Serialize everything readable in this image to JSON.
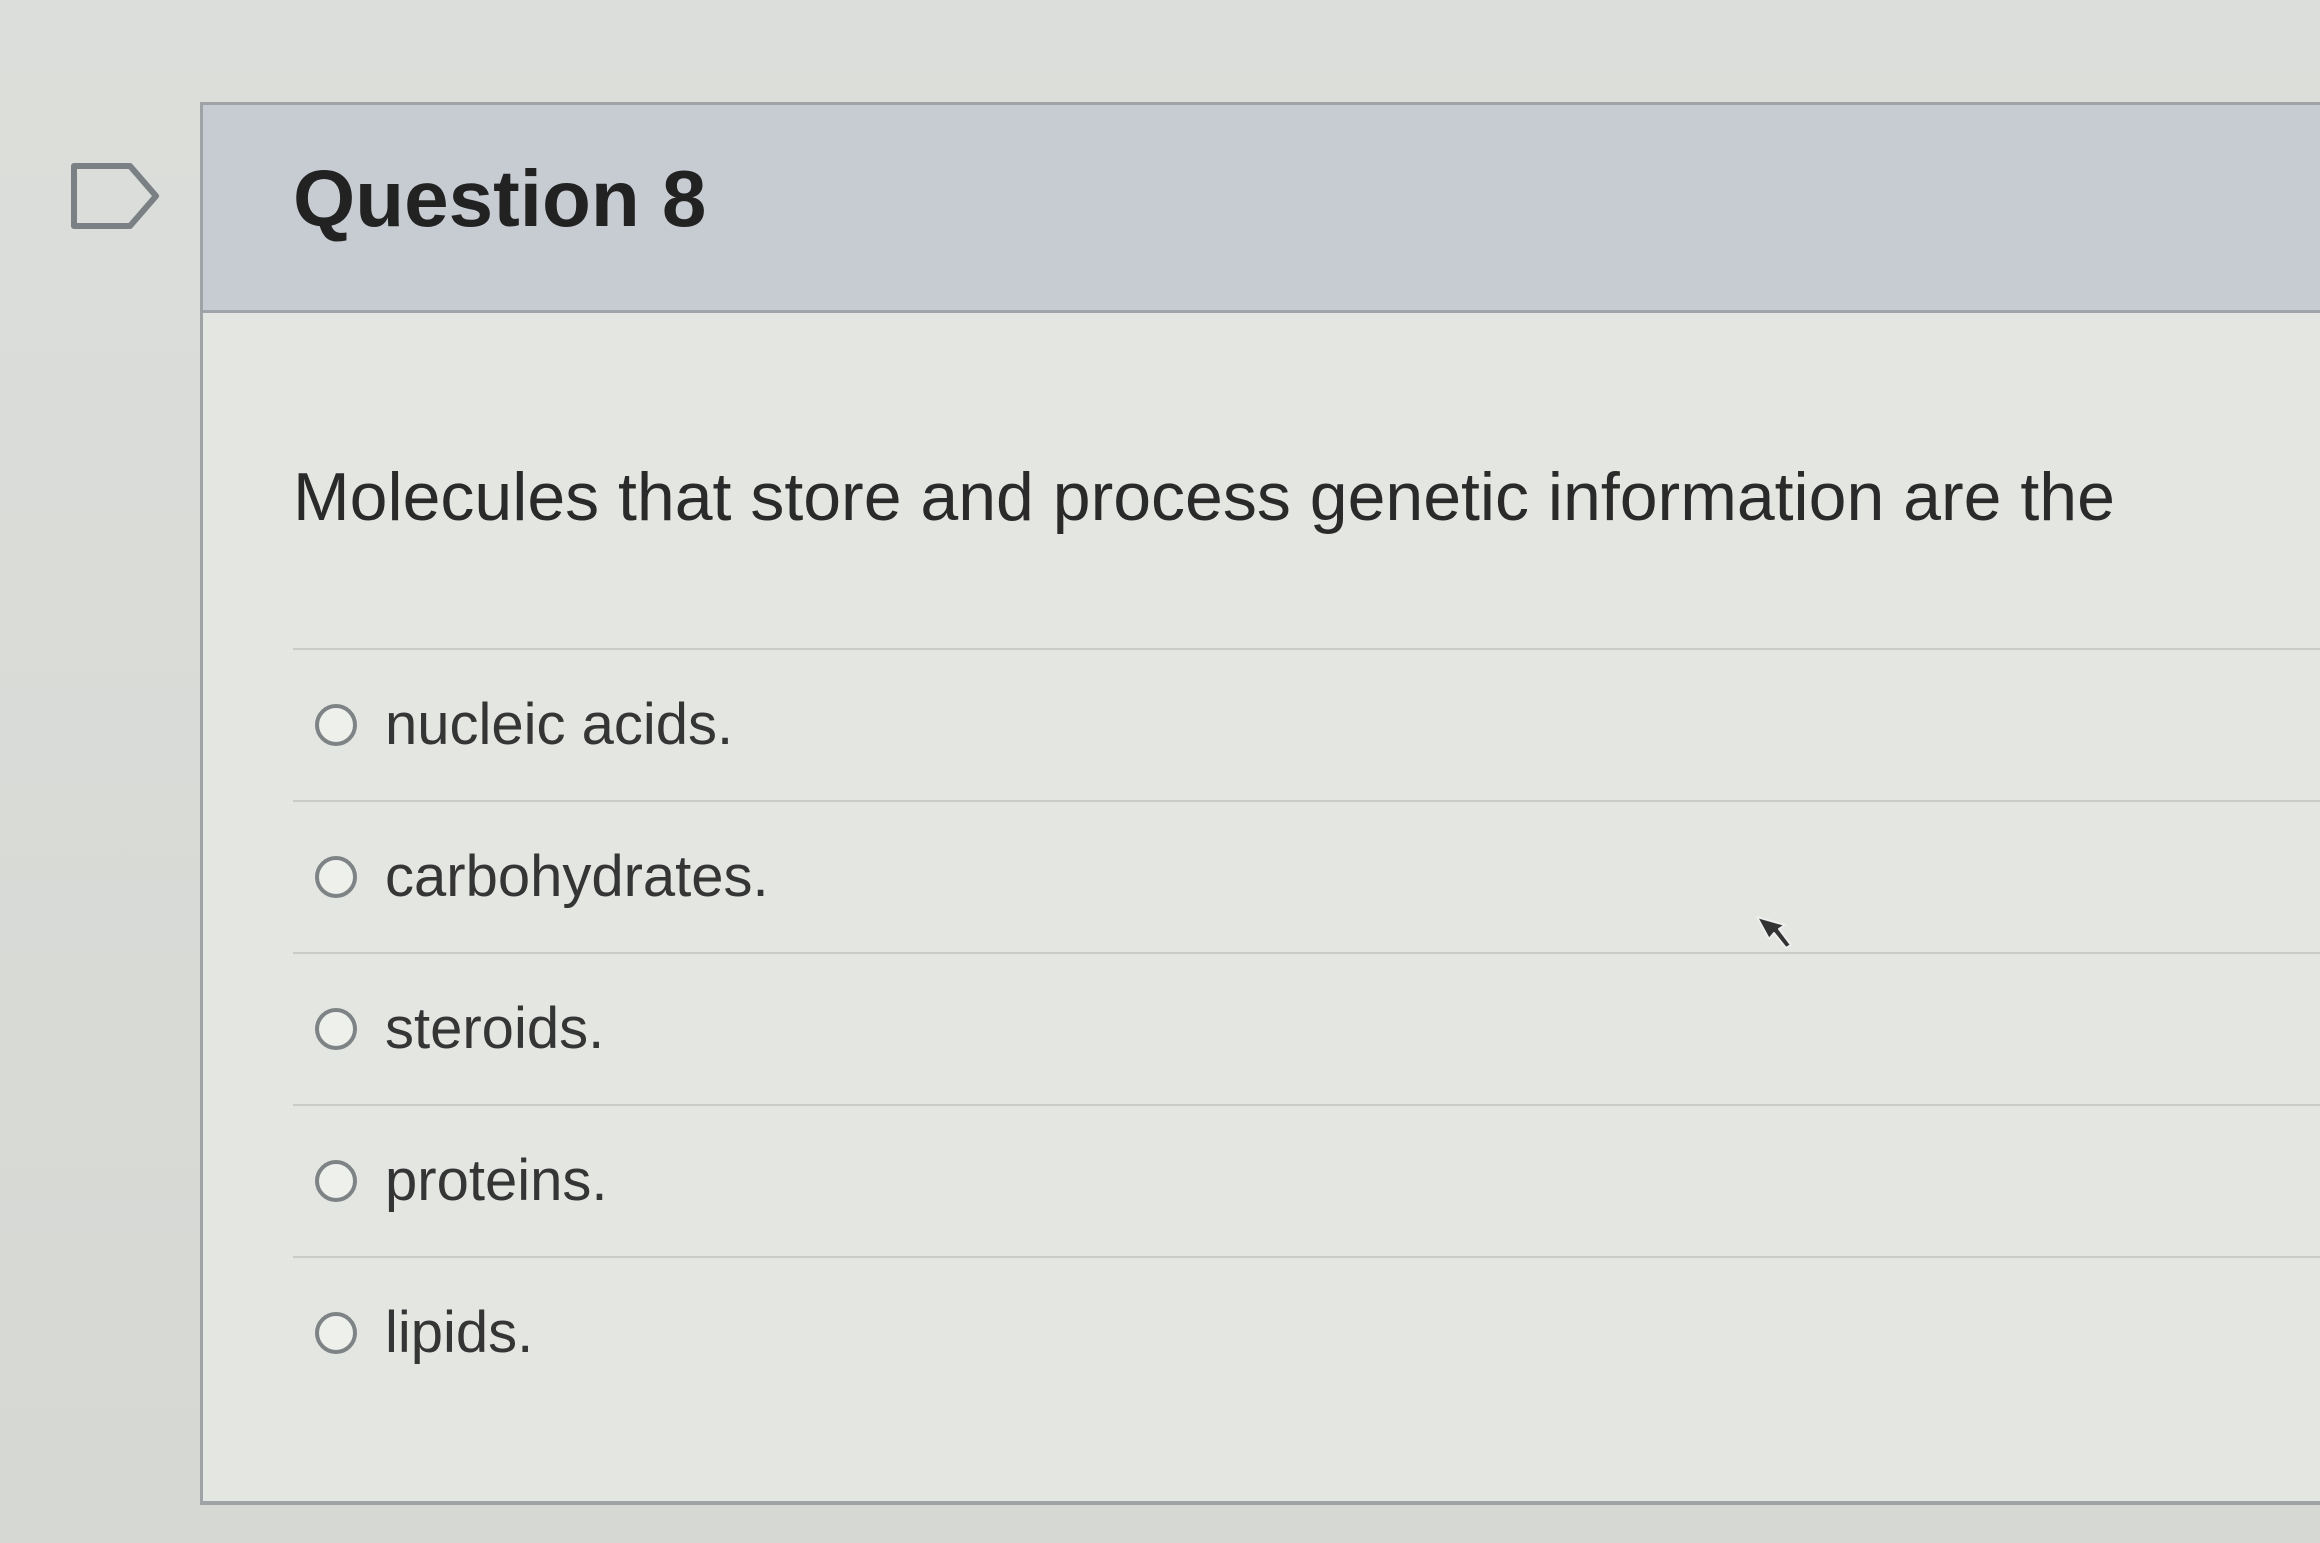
{
  "question": {
    "title": "Question 8",
    "prompt": "Molecules that store and process genetic information are the",
    "options": [
      {
        "label": "nucleic acids."
      },
      {
        "label": "carbohydrates."
      },
      {
        "label": "steroids."
      },
      {
        "label": "proteins."
      },
      {
        "label": "lipids."
      }
    ]
  },
  "icons": {
    "flag": "flag-icon",
    "radio": "radio-button-icon"
  },
  "colors": {
    "header_background": "#c7ccd3",
    "card_background": "#e4e6e2",
    "border": "#9fa3a6",
    "text": "#2d2d2d"
  }
}
